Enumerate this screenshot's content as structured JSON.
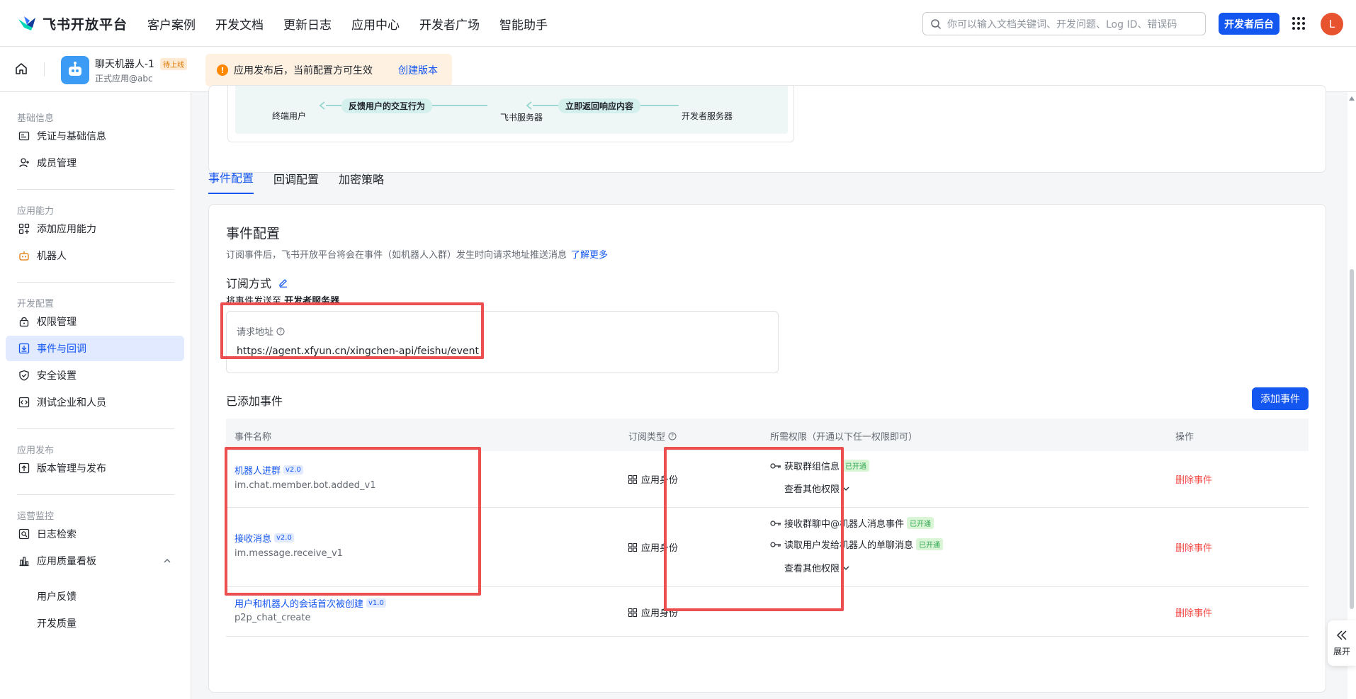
{
  "header": {
    "logo_text": "飞书开放平台",
    "nav": [
      "客户案例",
      "开发文档",
      "更新日志",
      "应用中心",
      "开发者广场",
      "智能助手"
    ],
    "search_placeholder": "你可以输入文档关键词、开发问题、Log ID、错误码",
    "dev_console_label": "开发者后台",
    "avatar_initial": "L"
  },
  "app_bar": {
    "app_name": "聊天机器人-1",
    "status_badge": "待上线",
    "app_sub": "正式应用@abc",
    "notice_text": "应用发布后，当前配置方可生效",
    "notice_link": "创建版本"
  },
  "sidebar": {
    "groups": {
      "basic": "基础信息",
      "ability": "应用能力",
      "dev": "开发配置",
      "publish": "应用发布",
      "ops": "运营监控"
    },
    "items": {
      "credentials": "凭证与基础信息",
      "members": "成员管理",
      "add_ability": "添加应用能力",
      "bot": "机器人",
      "permissions": "权限管理",
      "events": "事件与回调",
      "security": "安全设置",
      "test_org": "测试企业和人员",
      "versions": "版本管理与发布",
      "logs": "日志检索",
      "quality": "应用质量看板",
      "feedback": "用户反馈",
      "dev_quality": "开发质量"
    }
  },
  "flow": {
    "end_user": "终端用户",
    "feishu_server": "飞书服务器",
    "dev_server": "开发者服务器",
    "pill_feedback": "反馈用户的交互行为",
    "pill_respond": "立即返回响应内容"
  },
  "tabs": [
    "事件配置",
    "回调配置",
    "加密策略"
  ],
  "event_config": {
    "title": "事件配置",
    "desc": "订阅事件后，飞书开放平台将会在事件（如机器人入群）发生时向请求地址推送消息",
    "learn_more": "了解更多",
    "sub_mode_label": "订阅方式",
    "send_to_prefix": "将事件发送至",
    "send_to_target": "开发者服务器",
    "url_label": "请求地址",
    "url_value": "https://agent.xfyun.cn/xingchen-api/feishu/event",
    "added_title": "已添加事件",
    "add_button": "添加事件"
  },
  "table": {
    "headers": {
      "name": "事件名称",
      "type": "订阅类型",
      "perm": "所需权限（开通以下任一权限即可）",
      "ops": "操作"
    },
    "rows": [
      {
        "name": "机器人进群",
        "version": "v2.0",
        "code": "im.chat.member.bot.added_v1",
        "type": "应用身份",
        "perms": [
          {
            "label": "获取群组信息",
            "status": "已开通"
          }
        ],
        "more": "查看其他权限",
        "action": "删除事件"
      },
      {
        "name": "接收消息",
        "version": "v2.0",
        "code": "im.message.receive_v1",
        "type": "应用身份",
        "perms": [
          {
            "label": "接收群聊中@机器人消息事件",
            "status": "已开通"
          },
          {
            "label": "读取用户发给机器人的单聊消息",
            "status": "已开通"
          }
        ],
        "more": "查看其他权限",
        "action": "删除事件"
      },
      {
        "name": "用户和机器人的会话首次被创建",
        "version": "v1.0",
        "code": "p2p_chat_create",
        "type": "应用身份",
        "perm_empty": "-",
        "action": "删除事件"
      }
    ]
  },
  "expand_label": "展开",
  "colors": {
    "primary": "#1456f0",
    "danger": "#f54a45",
    "highlight": "#eb4f4f",
    "success": "#34a853"
  }
}
